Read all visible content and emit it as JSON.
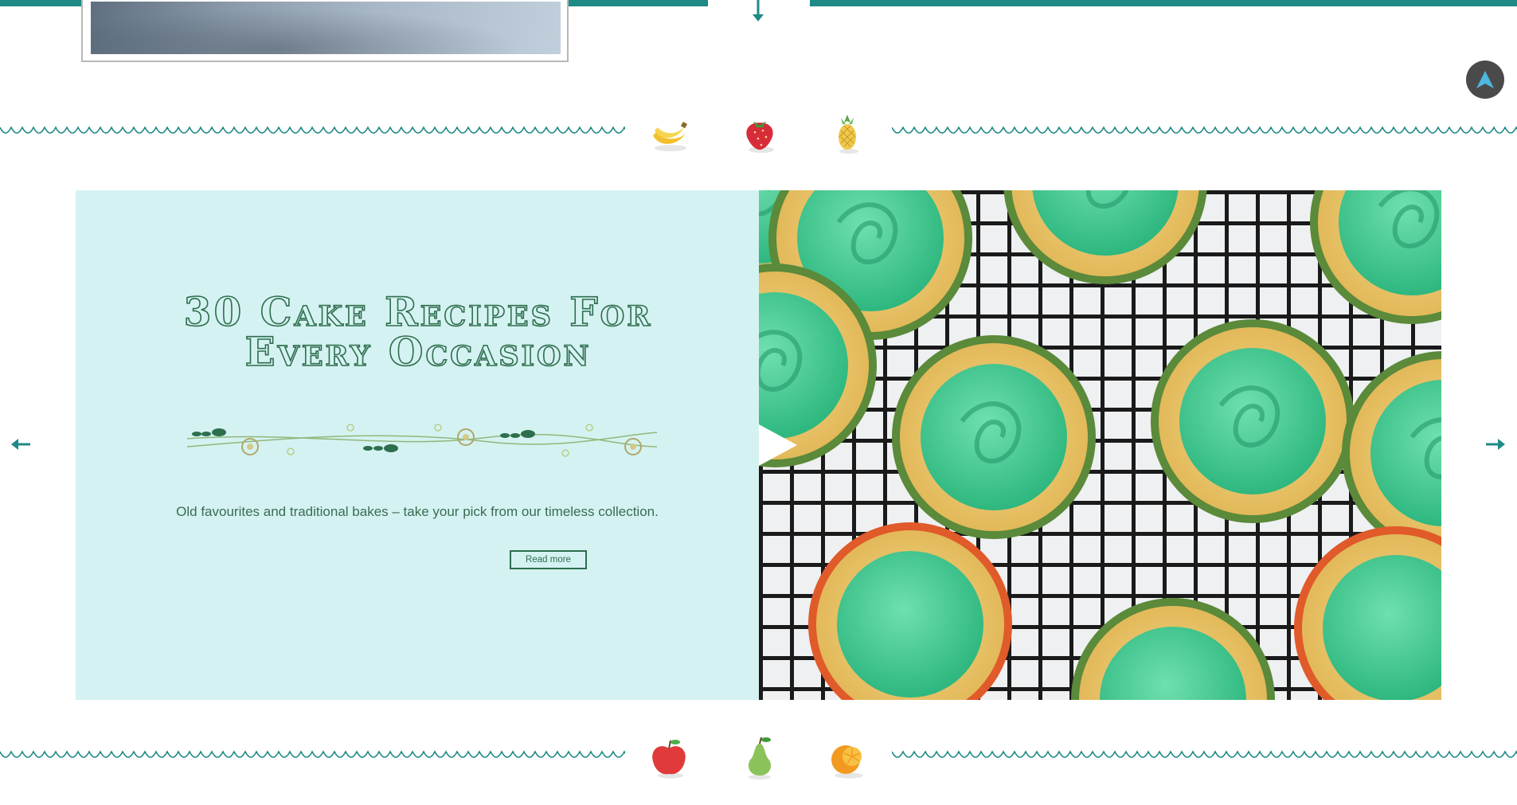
{
  "header": {
    "accent_color": "#1f8a86",
    "down_icon": "arrow-down-icon"
  },
  "previous_card": {
    "icon": "photo-thumbnail"
  },
  "scroll_top": {
    "icon": "navigation-arrow-icon",
    "color": "#4fb8e0"
  },
  "fruit_row_top": [
    "banana-icon",
    "strawberry-icon",
    "pineapple-icon"
  ],
  "fruit_row_bottom": [
    "apple-icon",
    "pear-icon",
    "orange-icon"
  ],
  "slide": {
    "title_line1": "30 Cake Recipes For",
    "title_line2": "Every Occasion",
    "description": "Old favourites and traditional bakes – take your pick from our timeless collection.",
    "read_more": "Read more",
    "background": "#d5f2f2",
    "text_color": "#2d6e4c"
  },
  "carousel": {
    "prev_icon": "arrow-left-icon",
    "next_icon": "arrow-right-icon"
  }
}
